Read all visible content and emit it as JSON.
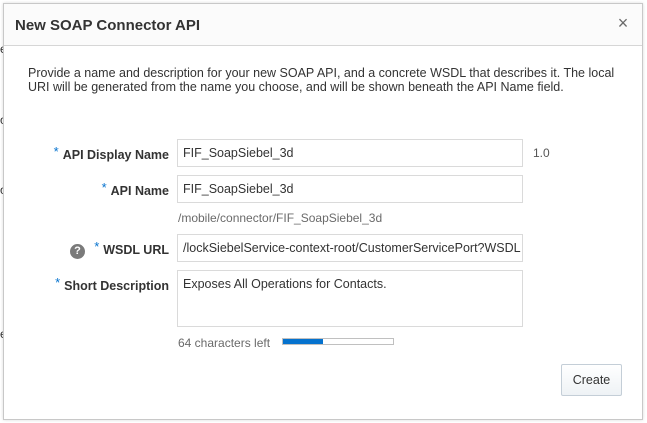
{
  "dialog": {
    "title": "New SOAP Connector API",
    "description": "Provide a name and description for your new SOAP API, and a concrete WSDL that describes it. The local URI will be generated from the name you choose, and will be shown beneath the API Name field."
  },
  "form": {
    "required_marker": "*",
    "display_name": {
      "label": "API Display Name",
      "value": "FIF_SoapSiebel_3d",
      "version": "1.0"
    },
    "api_name": {
      "label": "API Name",
      "value": "FIF_SoapSiebel_3d",
      "local_uri": "/mobile/connector/FIF_SoapSiebel_3d"
    },
    "wsdl_url": {
      "label": "WSDL URL",
      "value": "/lockSiebelService-context-root/CustomerServicePort?WSDL",
      "help_icon": "question-circle-icon"
    },
    "short_description": {
      "label": "Short Description",
      "value": "Exposes All Operations for Contacts.",
      "chars_left": "64 characters left",
      "fill_fraction": 0.36
    }
  },
  "buttons": {
    "create": "Create",
    "close_glyph": "×"
  },
  "colors": {
    "accent": "#0572ce"
  }
}
